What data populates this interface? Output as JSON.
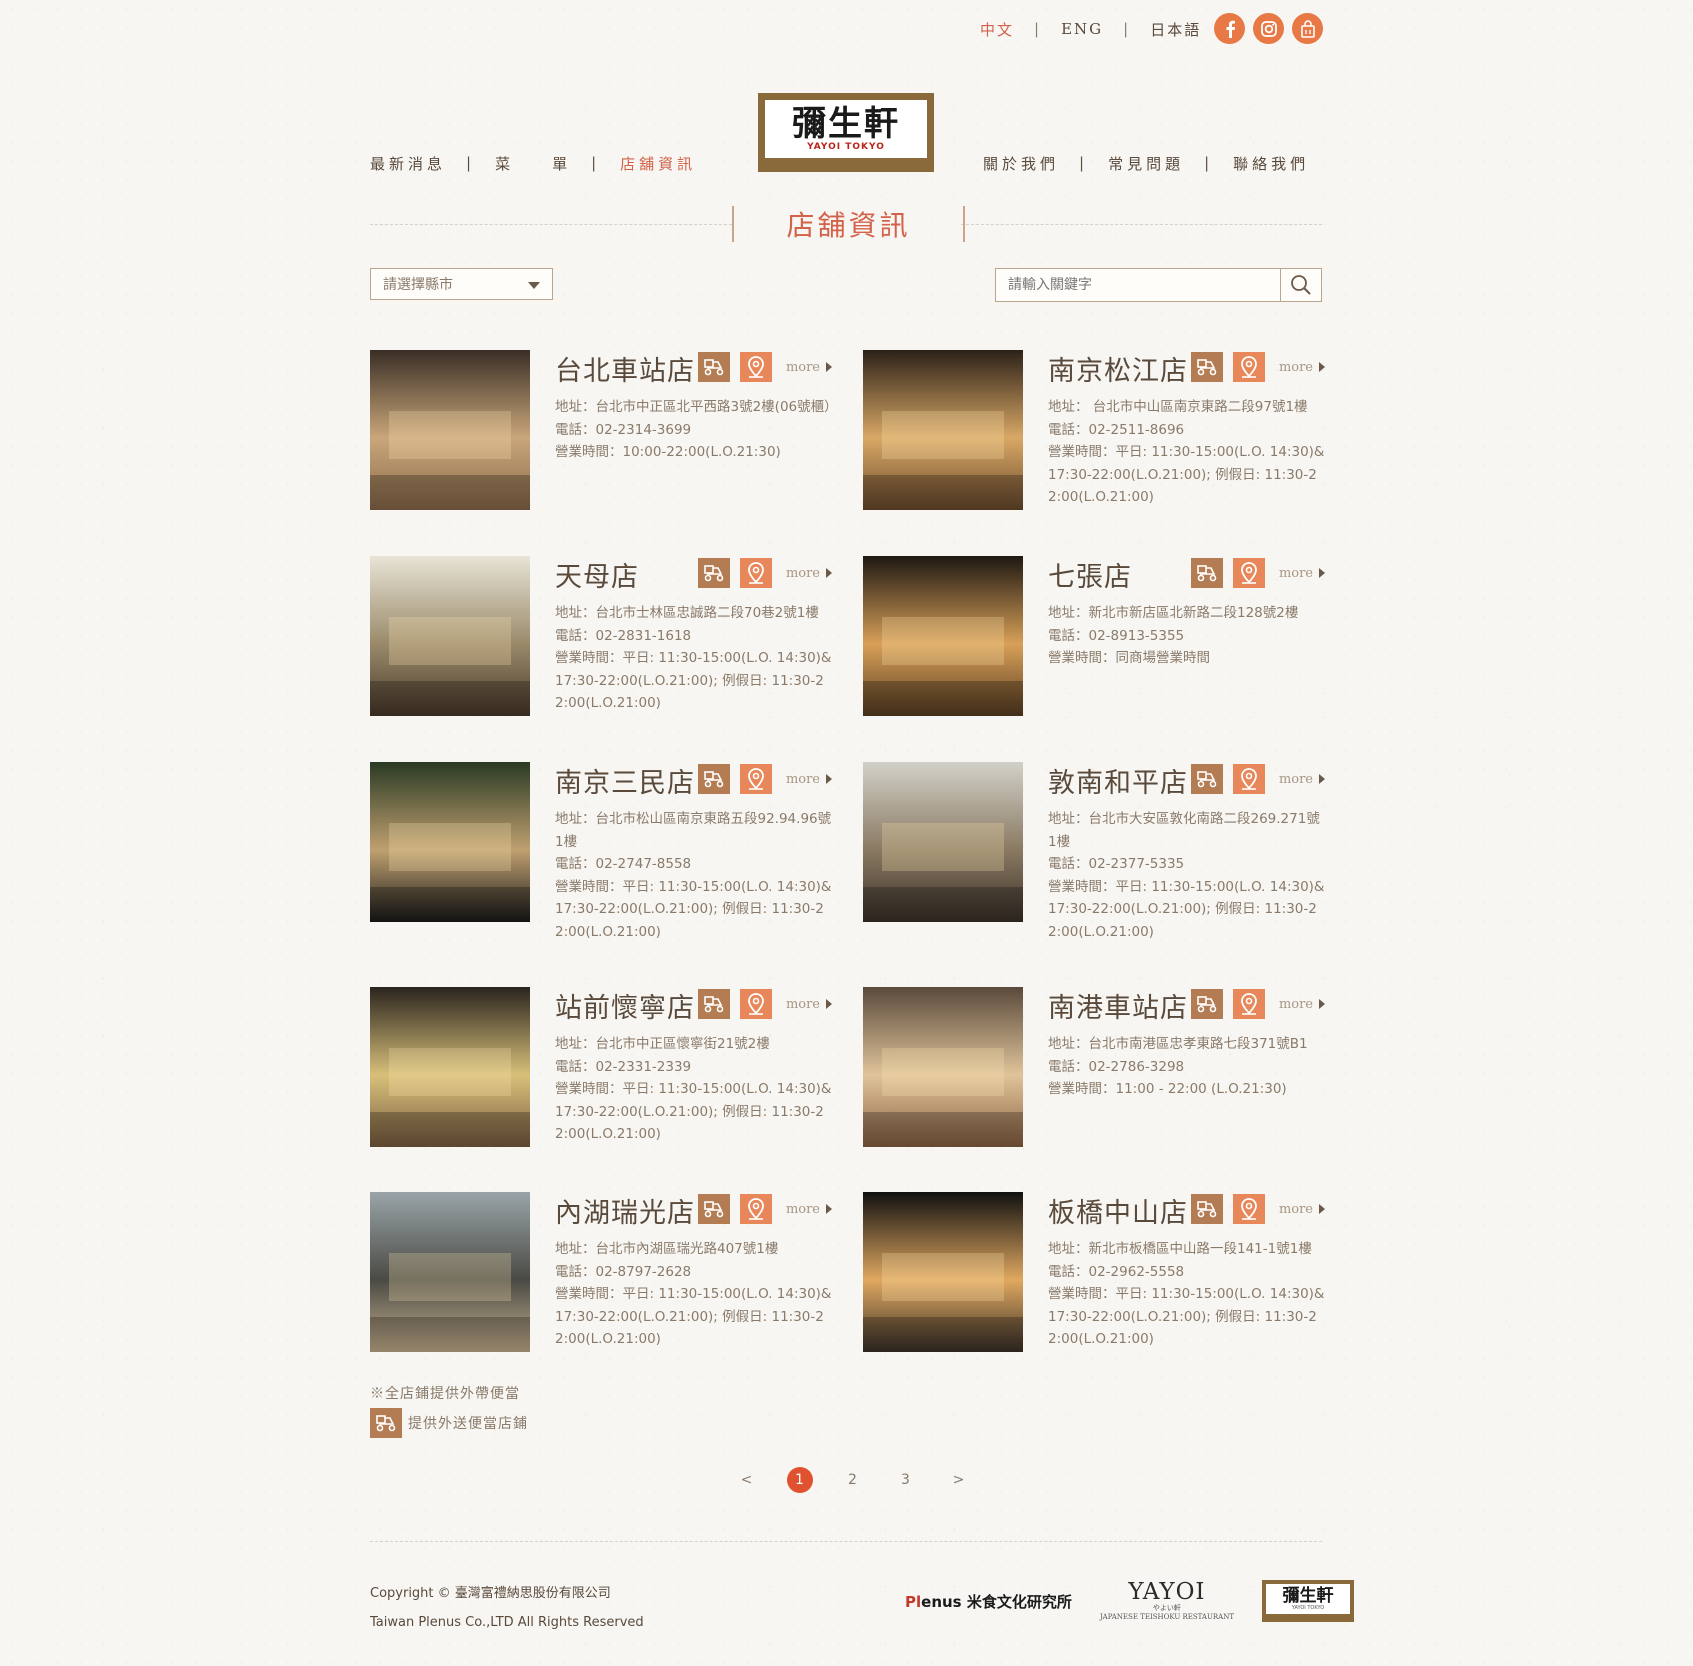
{
  "lang": {
    "zh": "中文",
    "en": "ENG",
    "jp": "日本語",
    "sep": "|"
  },
  "social": [
    "facebook-icon",
    "instagram-icon",
    "shopping-bag-icon"
  ],
  "logo": {
    "kanji": "彌生軒",
    "sub": "YAYOI TOKYO"
  },
  "nav": {
    "left": [
      "最新消息",
      "菜　　單",
      "店舖資訊"
    ],
    "right": [
      "關於我們",
      "常見問題",
      "聯絡我們"
    ],
    "sep": "|"
  },
  "page_title": "店舖資訊",
  "filter": {
    "select_label": "請選擇縣市",
    "search_placeholder": "請輸入關鍵字"
  },
  "more_label": "more",
  "stores": [
    {
      "name": "台北車站店",
      "lines": [
        "地址：台北市中正區北平西路3號2樓(06號櫃）",
        "電話：02-2314-3699",
        "營業時間：10:00-22:00(L.O.21:30)"
      ]
    },
    {
      "name": "南京松江店",
      "lines": [
        "地址： 台北市中山區南京東路二段97號1樓",
        "電話：02-2511-8696",
        "營業時間：平日: 11:30-15:00(L.O. 14:30)& 17:30-22:00(L.O.21:00); 例假日: 11:30-22:00(L.O.21:00)"
      ]
    },
    {
      "name": "天母店",
      "lines": [
        "地址：台北市士林區忠誠路二段70巷2號1樓",
        "電話：02-2831-1618",
        "營業時間：平日: 11:30-15:00(L.O. 14:30)& 17:30-22:00(L.O.21:00); 例假日: 11:30-22:00(L.O.21:00)"
      ]
    },
    {
      "name": "七張店",
      "lines": [
        "地址：新北市新店區北新路二段128號2樓",
        "電話：02-8913-5355",
        "營業時間：同商場營業時間"
      ]
    },
    {
      "name": "南京三民店",
      "lines": [
        "地址：台北市松山區南京東路五段92.94.96號1樓",
        "電話：02-2747-8558",
        "營業時間：平日: 11:30-15:00(L.O. 14:30)& 17:30-22:00(L.O.21:00); 例假日: 11:30-22:00(L.O.21:00)"
      ]
    },
    {
      "name": "敦南和平店",
      "lines": [
        "地址：台北市大安區敦化南路二段269.271號1樓",
        "電話：02-2377-5335",
        "營業時間：平日: 11:30-15:00(L.O. 14:30)& 17:30-22:00(L.O.21:00); 例假日: 11:30-22:00(L.O.21:00)"
      ]
    },
    {
      "name": "站前懷寧店",
      "lines": [
        "地址：台北市中正區懷寧街21號2樓",
        "電話：02-2331-2339",
        "營業時間：平日: 11:30-15:00(L.O. 14:30)& 17:30-22:00(L.O.21:00); 例假日: 11:30-22:00(L.O.21:00)"
      ]
    },
    {
      "name": "南港車站店",
      "lines": [
        "地址：台北市南港區忠孝東路七段371號B1",
        "電話：02-2786-3298",
        "營業時間：11:00 - 22:00 (L.O.21:30)"
      ]
    },
    {
      "name": "內湖瑞光店",
      "lines": [
        "地址：台北市內湖區瑞光路407號1樓",
        "電話：02-8797-2628",
        "營業時間：平日: 11:30-15:00(L.O. 14:30)& 17:30-22:00(L.O.21:00); 例假日: 11:30-22:00(L.O.21:00)"
      ]
    },
    {
      "name": "板橋中山店",
      "lines": [
        "地址：新北市板橋區中山路一段141-1號1樓",
        "電話：02-2962-5558",
        "營業時間：平日: 11:30-15:00(L.O. 14:30)& 17:30-22:00(L.O.21:00); 例假日: 11:30-22:00(L.O.21:00)"
      ]
    }
  ],
  "notes": {
    "takeout": "※全店鋪提供外帶便當",
    "delivery": "提供外送便當店鋪"
  },
  "pager": {
    "prev": "<",
    "pages": [
      "1",
      "2",
      "3"
    ],
    "next": ">",
    "current": "1"
  },
  "footer": {
    "copyright": "Copyright © 臺灣富禮納思股份有限公司",
    "rights": "Taiwan Plenus Co.,LTD All Rights Reserved",
    "plenus_pl": "Pl",
    "plenus_rest": "enus 米食文化研究所",
    "yayoi_word": "YAYOI",
    "yayoi_small": "やよい軒",
    "yayoi_tag": "JAPANESE TEISHOKU RESTAURANT",
    "kanji_logo": "彌生軒",
    "kanji_logo_sub": "YAYOI TOKYO"
  },
  "colors": {
    "accent": "#d4614a",
    "brown": "#8a6a3a",
    "orange": "#e7875a",
    "page_bg": "#f7f6f2"
  }
}
